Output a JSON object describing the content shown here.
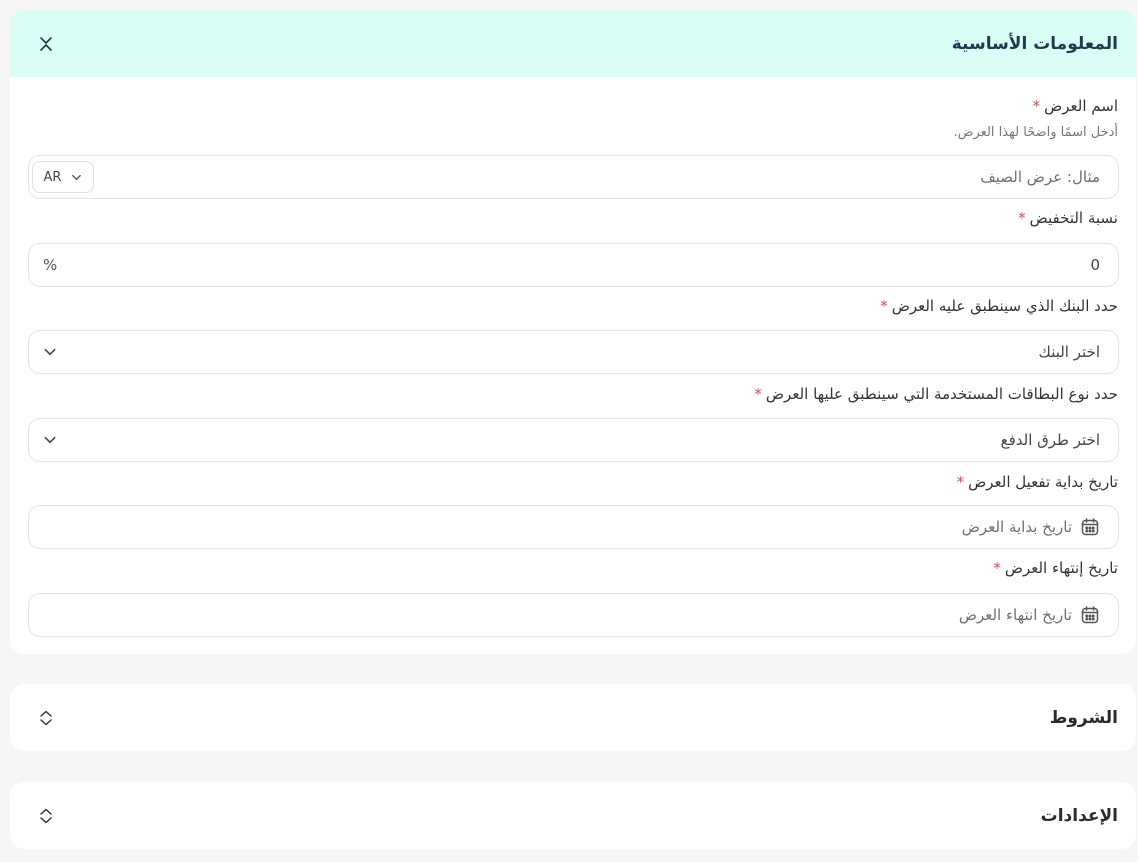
{
  "sections": {
    "basic": {
      "title": "المعلومات الأساسية",
      "offer_name": {
        "label": "اسم العرض",
        "required": "*",
        "hint": "أدخل اسمًا واضحًا لهذا العرض.",
        "placeholder": "مثال: عرض الصيف",
        "lang": "AR"
      },
      "discount": {
        "label": "نسبة التخفيض",
        "required": "*",
        "value": "0",
        "suffix": "%"
      },
      "bank": {
        "label": "حدد البنك الذي سينطبق عليه العرض",
        "required": "*",
        "placeholder": "اختر البنك"
      },
      "card_type": {
        "label": "حدد نوع البطاقات المستخدمة التي سينطبق عليها العرض",
        "required": "*",
        "placeholder": "اختر طرق الدفع"
      },
      "start_date": {
        "label": "تاريخ بداية تفعيل العرض",
        "required": "*",
        "placeholder": "تاريخ بداية العرض"
      },
      "end_date": {
        "label": "تاريخ إنتهاء العرض",
        "required": "*",
        "placeholder": "تاريخ انتهاء العرض"
      }
    },
    "terms": {
      "title": "الشروط"
    },
    "settings": {
      "title": "الإعدادات"
    }
  },
  "icons": {
    "collapse": "chevrons-collapse-icon",
    "expand": "chevrons-expand-icon",
    "chevron": "chevron-down-icon",
    "calendar": "calendar-icon"
  },
  "colors": {
    "header_bg": "#d9fcf4",
    "title_color": "#1e3a4c",
    "required": "#e5484d"
  }
}
